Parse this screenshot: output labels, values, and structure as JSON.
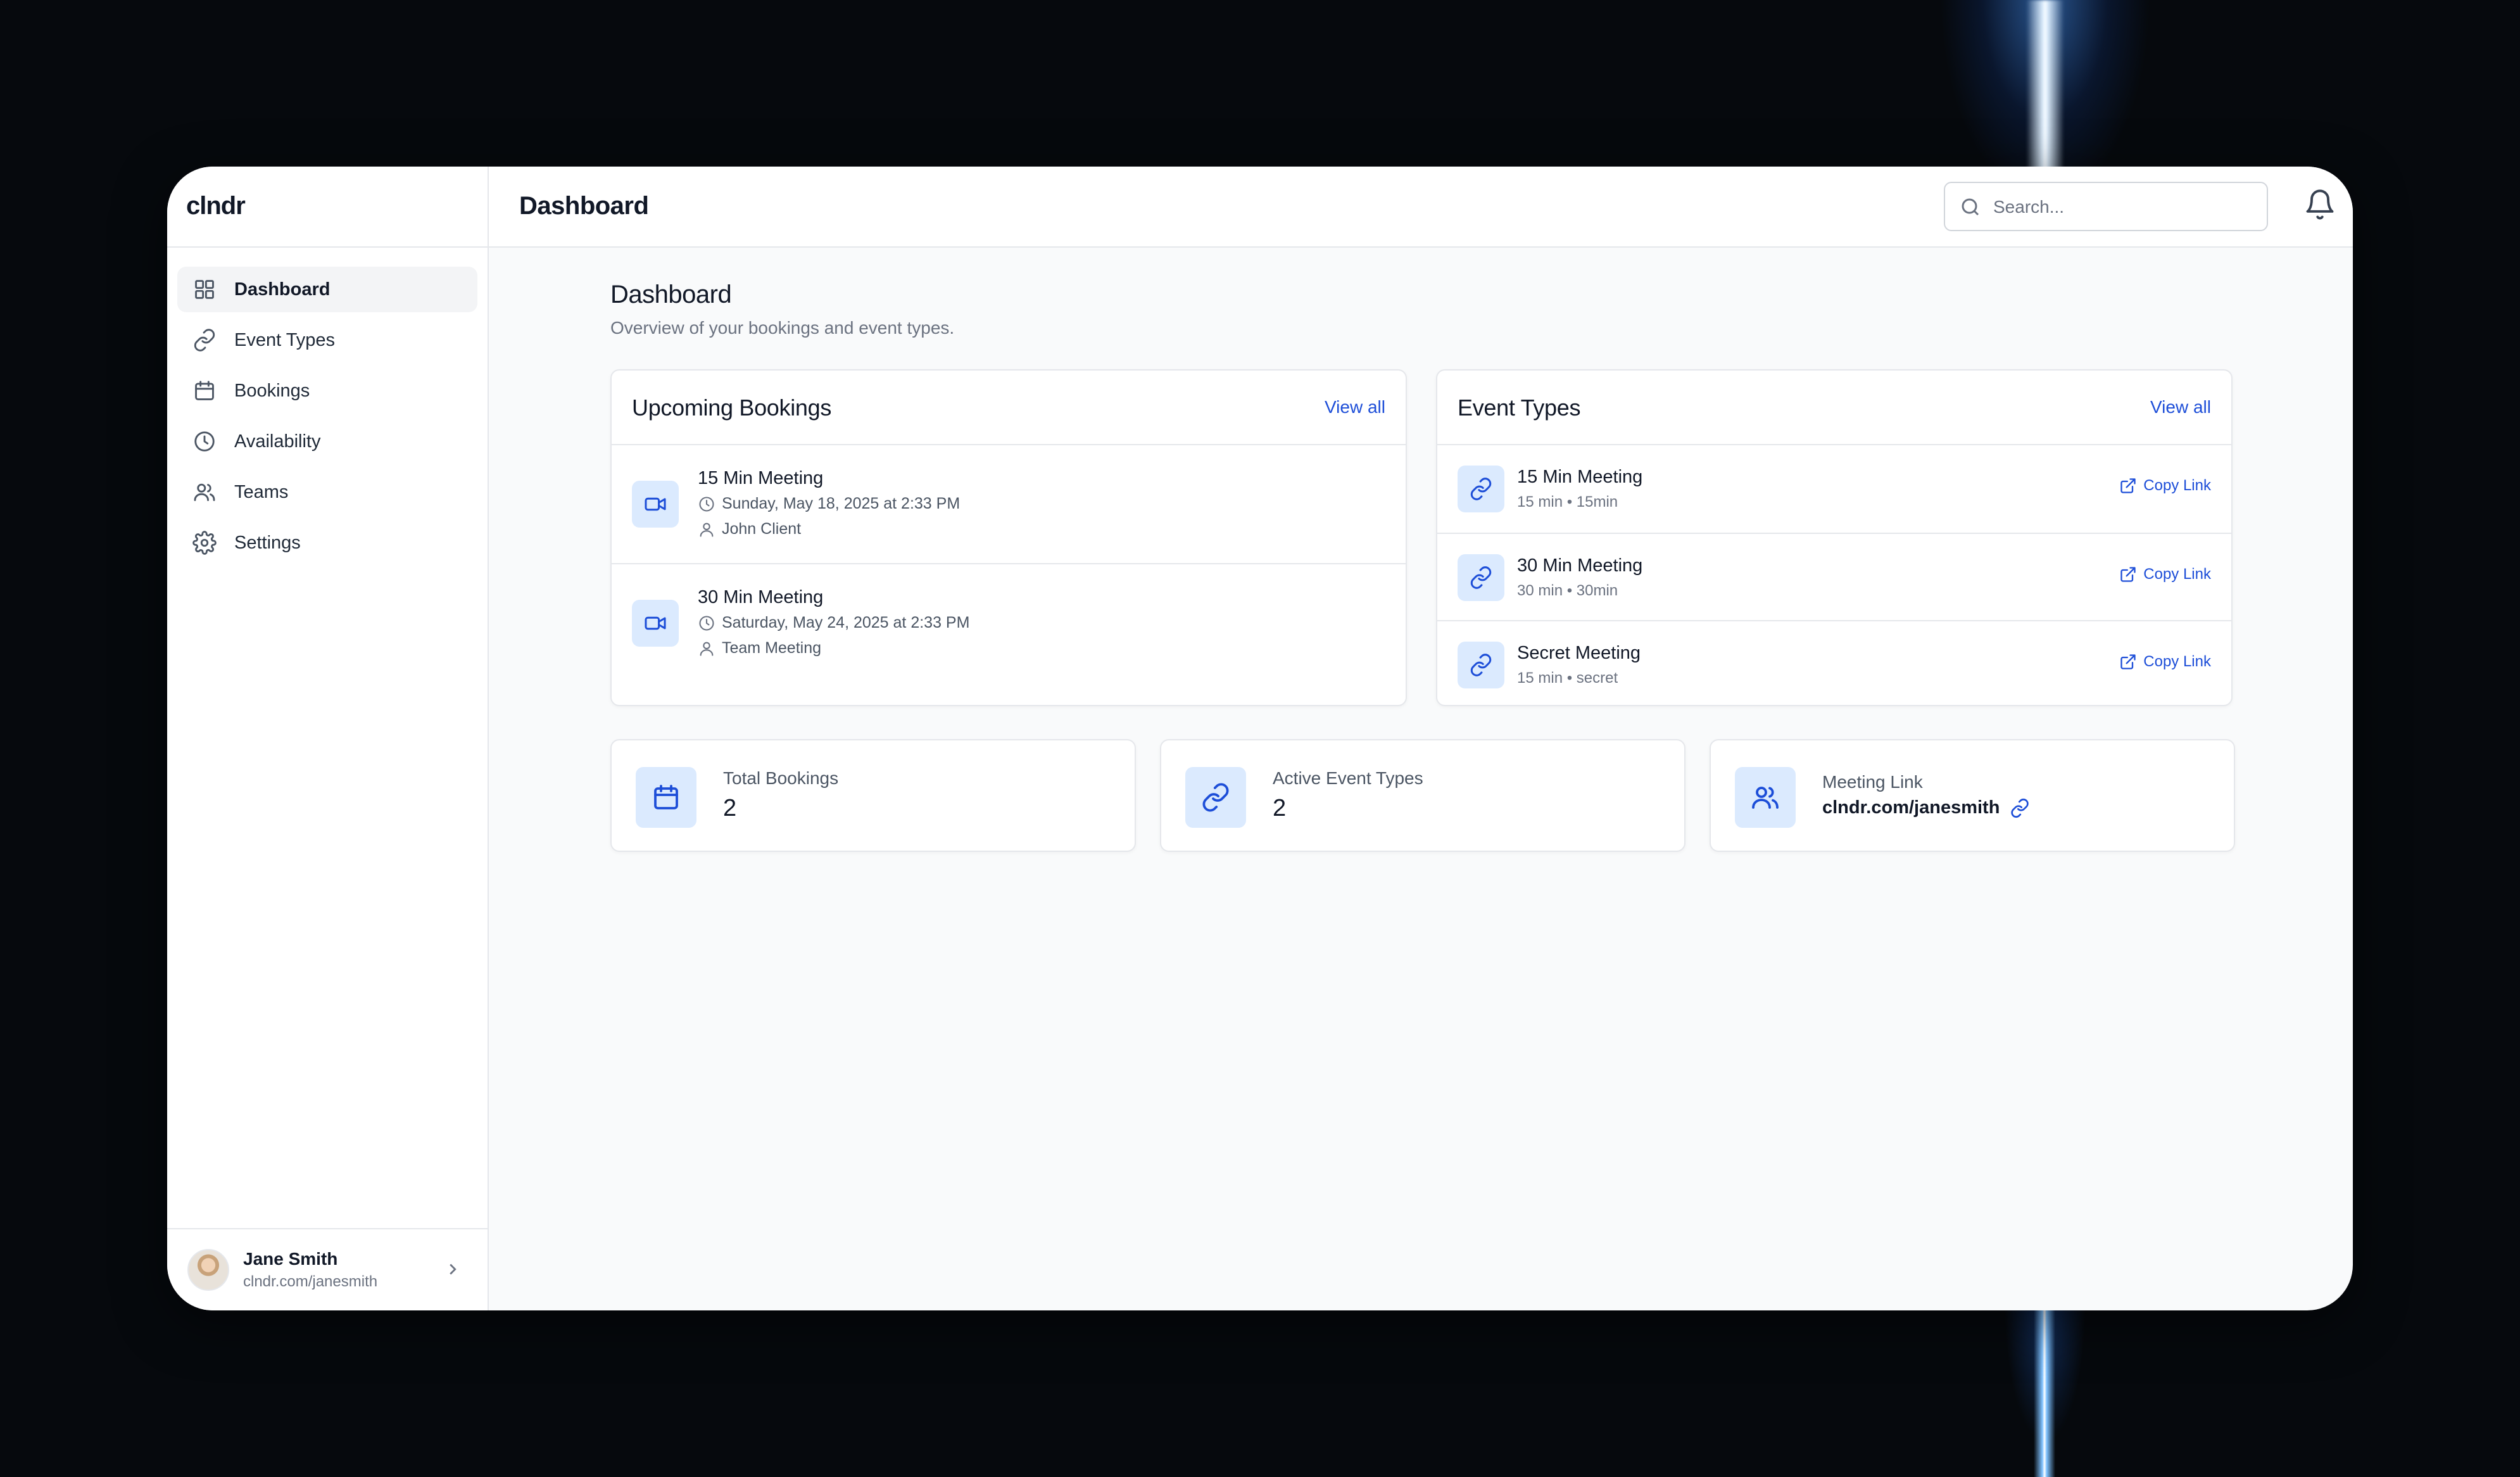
{
  "app": {
    "brand": "clndr",
    "header_title": "Dashboard"
  },
  "search": {
    "placeholder": "Search..."
  },
  "sidebar": {
    "items": [
      {
        "label": "Dashboard",
        "icon": "grid-icon",
        "active": true
      },
      {
        "label": "Event Types",
        "icon": "link-icon"
      },
      {
        "label": "Bookings",
        "icon": "calendar-icon"
      },
      {
        "label": "Availability",
        "icon": "clock-icon"
      },
      {
        "label": "Teams",
        "icon": "users-icon"
      },
      {
        "label": "Settings",
        "icon": "gear-icon"
      }
    ],
    "user": {
      "name": "Jane Smith",
      "url": "clndr.com/janesmith"
    }
  },
  "page": {
    "title": "Dashboard",
    "subtitle": "Overview of your bookings and event types."
  },
  "bookings": {
    "title": "Upcoming Bookings",
    "view_all": "View all",
    "items": [
      {
        "title": "15 Min Meeting",
        "when": "Sunday, May 18, 2025 at 2:33 PM",
        "who": "John Client",
        "icon": "video-icon"
      },
      {
        "title": "30 Min Meeting",
        "when": "Saturday, May 24, 2025 at 2:33 PM",
        "who": "Team Meeting",
        "icon": "video-icon"
      }
    ]
  },
  "event_types": {
    "title": "Event Types",
    "view_all": "View all",
    "items": [
      {
        "title": "15 Min Meeting",
        "sub": "15 min • 15min",
        "action": "Copy Link"
      },
      {
        "title": "30 Min Meeting",
        "sub": "30 min • 30min",
        "action": "Copy Link"
      },
      {
        "title": "Secret Meeting",
        "sub": "15 min • secret",
        "action": "Copy Link"
      }
    ]
  },
  "stats": {
    "total_bookings": {
      "label": "Total Bookings",
      "value": "2"
    },
    "active_event_types": {
      "label": "Active Event Types",
      "value": "2"
    },
    "meeting_link": {
      "label": "Meeting Link",
      "value": "clndr.com/janesmith"
    }
  },
  "colors": {
    "accent": "#1d4ed8",
    "accent_tile": "#dbeafe",
    "background": "#f9fafb"
  }
}
